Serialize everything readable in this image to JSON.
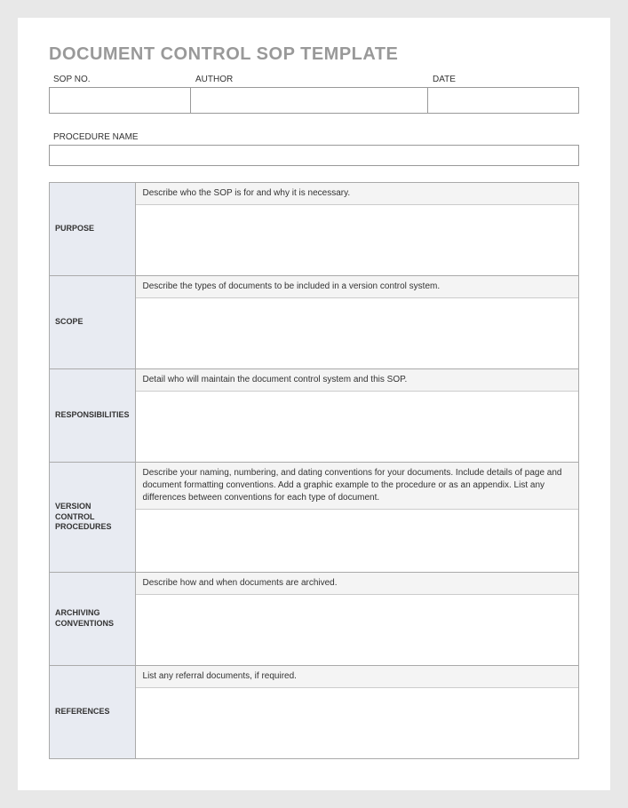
{
  "title": "DOCUMENT CONTROL SOP TEMPLATE",
  "header": {
    "sop_no_label": "SOP NO.",
    "author_label": "AUTHOR",
    "date_label": "DATE",
    "sop_no_value": "",
    "author_value": "",
    "date_value": ""
  },
  "procedure": {
    "label": "PROCEDURE NAME",
    "value": ""
  },
  "sections": [
    {
      "label": "PURPOSE",
      "description": "Describe who the SOP is for and why it is necessary.",
      "content": ""
    },
    {
      "label": "SCOPE",
      "description": "Describe the types of documents to be included in a version control system.",
      "content": ""
    },
    {
      "label": "RESPONSIBILITIES",
      "description": "Detail who will maintain the document control system and this SOP.",
      "content": ""
    },
    {
      "label": "VERSION CONTROL PROCEDURES",
      "description": "Describe your naming, numbering, and dating conventions for your documents. Include details of page and document formatting conventions.  Add a graphic example to the procedure or as an appendix.  List any differences between conventions for each type of document.",
      "content": ""
    },
    {
      "label": "ARCHIVING CONVENTIONS",
      "description": "Describe how and when documents are archived.",
      "content": ""
    },
    {
      "label": "REFERENCES",
      "description": "List any referral documents, if required.",
      "content": ""
    }
  ]
}
